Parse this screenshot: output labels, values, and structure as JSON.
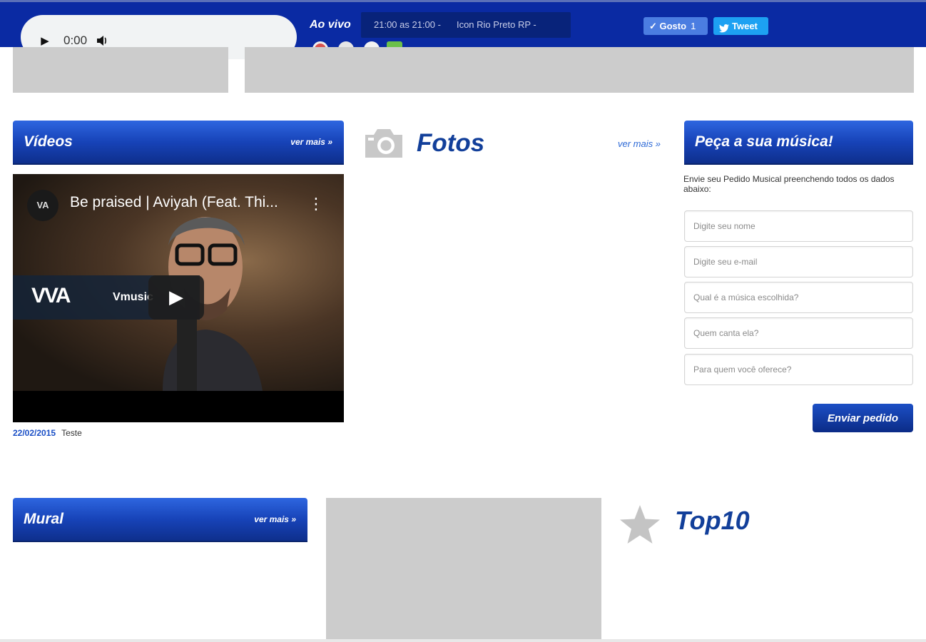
{
  "player": {
    "play_glyph": "▶",
    "time": "0:00",
    "volume_glyph": "🔊"
  },
  "live": {
    "label": "Ao vivo",
    "schedule": "21:00 as 21:00 -",
    "program": "Icon Rio Preto RP -"
  },
  "social": {
    "like_label": "✓ Gosto",
    "like_count": "1",
    "tweet_label": "Tweet"
  },
  "colors": {
    "topbar": "#0a2aa3",
    "header_blue": "#123f9a",
    "link_blue": "#2b68d6",
    "banner_gray": "#cccccc"
  },
  "videos": {
    "title": "Vídeos",
    "more": "ver mais »",
    "item": {
      "channel_initials": "VA",
      "title": "Be praised | Aviyah (Feat. Thi...",
      "brand_logo": "VVA",
      "brand_name": "Vmusic",
      "date": "22/02/2015",
      "caption": "Teste"
    }
  },
  "fotos": {
    "icon": "camera-icon",
    "title": "Fotos",
    "more": "ver mais »"
  },
  "request": {
    "title": "Peça a sua música!",
    "intro": "Envie seu Pedido Musical preenchendo todos os dados abaixo:",
    "fields": {
      "name": "Digite seu nome",
      "email": "Digite seu e-mail",
      "song": "Qual é a música escolhida?",
      "artist": "Quem canta ela?",
      "dedication": "Para quem você oferece?"
    },
    "submit": "Enviar pedido"
  },
  "mural": {
    "title": "Mural",
    "more": "ver mais »"
  },
  "top10": {
    "icon": "star-icon",
    "title": "Top10"
  }
}
